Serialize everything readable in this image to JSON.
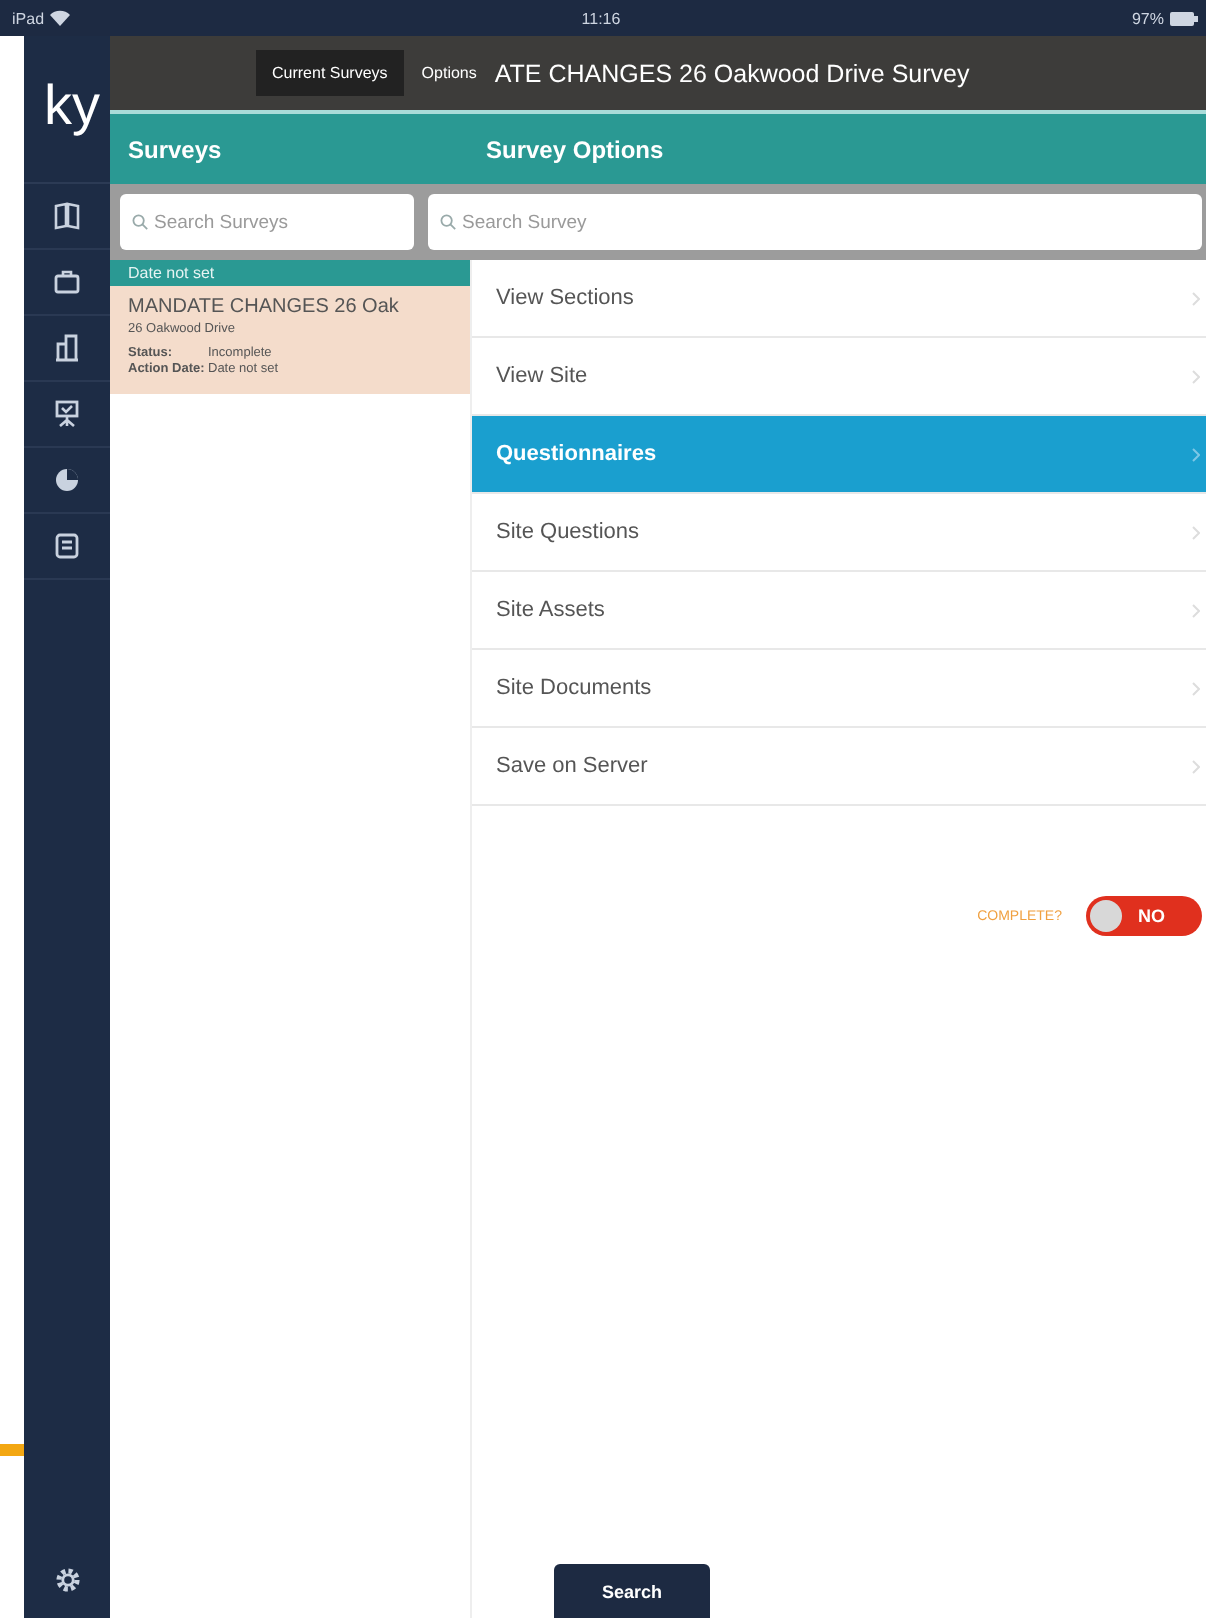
{
  "status_bar": {
    "device": "iPad",
    "time": "11:16",
    "battery": "97%"
  },
  "logo": "ky",
  "sidebar": {
    "items": [
      {
        "kind": "map"
      },
      {
        "kind": "briefcase"
      },
      {
        "kind": "building"
      },
      {
        "kind": "easel"
      },
      {
        "kind": "pie"
      },
      {
        "kind": "clipboard"
      }
    ]
  },
  "top_bar": {
    "tabs": [
      {
        "label": "Current Surveys",
        "selected": true
      },
      {
        "label": "Options",
        "selected": false
      }
    ],
    "title": "ATE CHANGES 26 Oakwood Drive Survey"
  },
  "surveys": {
    "title": "Surveys",
    "search": {
      "placeholder": "Search Surveys"
    },
    "groups": [
      {
        "header": "Date not set",
        "items": [
          {
            "title": "MANDATE CHANGES 26 Oak",
            "address": "26 Oakwood Drive",
            "fields": [
              {
                "label": "Status:",
                "value": "Incomplete"
              },
              {
                "label": "Action Date:",
                "value": "Date not set"
              }
            ],
            "selected": true
          }
        ]
      }
    ]
  },
  "survey_options": {
    "title": "Survey Options",
    "search": {
      "placeholder": "Search Survey"
    },
    "items": [
      {
        "label": "View Sections",
        "selected": false
      },
      {
        "label": "View Site",
        "selected": false
      },
      {
        "label": "Questionnaires",
        "selected": true
      },
      {
        "label": "Site Questions",
        "selected": false
      },
      {
        "label": "Site Assets",
        "selected": false
      },
      {
        "label": "Site Documents",
        "selected": false
      },
      {
        "label": "Save on Server",
        "selected": false
      }
    ],
    "complete": {
      "label": "COMPLETE?",
      "on": false,
      "state_text": "NO"
    }
  },
  "search_button": "Search"
}
